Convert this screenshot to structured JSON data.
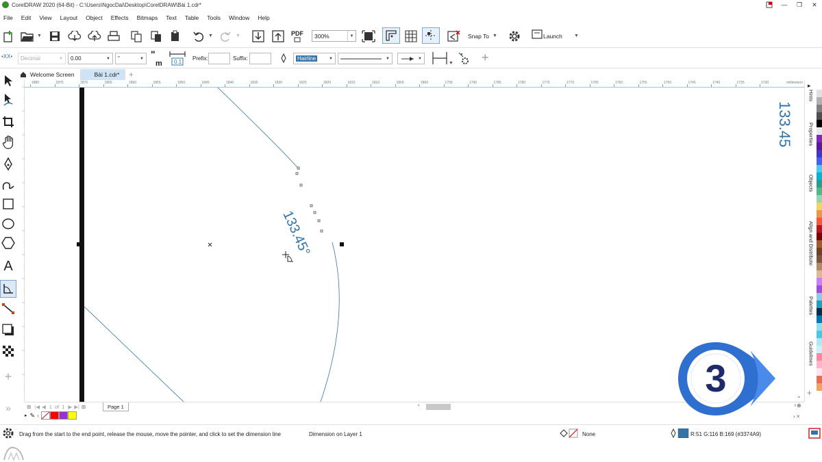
{
  "window": {
    "title": "CorelDRAW 2020 (64-Bit) - C:\\Users\\NgocDai\\Desktop\\CorelDRAW\\Bài 1.cdr*",
    "controls": [
      "minimize-icon",
      "restore-icon",
      "close-icon"
    ]
  },
  "menu": {
    "items": [
      "File",
      "Edit",
      "View",
      "Layout",
      "Object",
      "Effects",
      "Bitmaps",
      "Text",
      "Table",
      "Tools",
      "Window",
      "Help"
    ]
  },
  "toolbar": {
    "zoom": "300%",
    "snap_to": "Snap To",
    "launch": "Launch",
    "pdf": "PDF"
  },
  "propbar": {
    "style_label": "Decimal",
    "precision": "0.00",
    "units": "\"",
    "prefix_label": "Prefix:",
    "suffix_label": "Suffix:",
    "prefix_value": "",
    "suffix_value": "",
    "outline_width": "Hairline"
  },
  "tabs": {
    "welcome": "Welcome Screen",
    "doc": "Bài 1.cdr*"
  },
  "ruler": {
    "ticks": [
      "1880",
      "1875",
      "1870",
      "1865",
      "1860",
      "1855",
      "1850",
      "1845",
      "1840",
      "1835",
      "1830",
      "1825",
      "1820",
      "1815",
      "1810",
      "1805",
      "1800",
      "1795",
      "1790",
      "1785",
      "1780",
      "1775",
      "1770",
      "1765",
      "1760",
      "1755",
      "1750",
      "1745",
      "1740",
      "1735",
      "1730"
    ],
    "unit": "millimeters"
  },
  "canvas": {
    "dimension_text": "133.45°",
    "right_text": "133.45"
  },
  "pagenav": {
    "current": "1",
    "of": "of",
    "total": "1",
    "page_tab": "Page 1"
  },
  "palette_swatches": [
    "#ffffff",
    "#ff0000",
    "#9b30d0",
    "#ffff00"
  ],
  "status": {
    "hint": "Drag from the start to the end point, release the mouse, move the pointer, and click to set the dimension line",
    "layer": "Dimension on Layer 1",
    "fill": "None",
    "outline": "R:51 G:116 B:169 (#3374A9)",
    "outline_color": "#3374A9"
  },
  "dockers": [
    "Hints",
    "Properties",
    "Objects",
    "Align and Distribute",
    "Palettes",
    "Guidelines"
  ],
  "color_palette": [
    "#ffffff",
    "#e0e0e0",
    "#b0b0b0",
    "#808080",
    "#505050",
    "#000000",
    "#e8e8e8",
    "#7b2cbf",
    "#5a189a",
    "#3f37c9",
    "#4361ee",
    "#4cc9f0",
    "#00b4d8",
    "#2a9d8f",
    "#52b788",
    "#95d5b2",
    "#f4d35e",
    "#ee964b",
    "#f95738",
    "#c1121f",
    "#780000",
    "#a05a2c",
    "#6b4226",
    "#7f5539",
    "#b08968",
    "#ddb892",
    "#c77dff",
    "#9d4edd",
    "#8ecae6",
    "#219ebc",
    "#023047",
    "#0077b6",
    "#90e0ef",
    "#48cae4",
    "#ade8f4",
    "#caf0f8",
    "#ff85a1",
    "#ffb3c6",
    "#ffe5ec",
    "#e76f51",
    "#f4a261"
  ],
  "badge": {
    "number": "3",
    "color": "#2f6fd0"
  }
}
